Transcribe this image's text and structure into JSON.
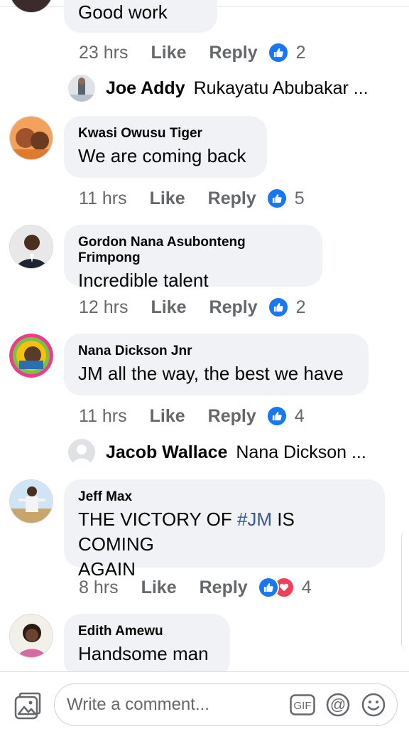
{
  "comments": [
    {
      "author": "",
      "text": "Good work",
      "time": "23 hrs",
      "like": "Like",
      "reply": "Reply",
      "reaction_count": "2",
      "reply_preview": {
        "name": "Joe Addy",
        "text": "Rukayatu Abubakar ..."
      }
    },
    {
      "author": "Kwasi Owusu Tiger",
      "text": "We are coming back",
      "time": "11 hrs",
      "like": "Like",
      "reply": "Reply",
      "reaction_count": "5"
    },
    {
      "author": "Gordon Nana Asubonteng Frimpong",
      "text": "Incredible talent",
      "time": "12 hrs",
      "like": "Like",
      "reply": "Reply",
      "reaction_count": "2"
    },
    {
      "author": "Nana Dickson Jnr",
      "text": "JM all the way, the best we have",
      "time": "11 hrs",
      "like": "Like",
      "reply": "Reply",
      "reaction_count": "4",
      "reply_preview": {
        "name": "Jacob Wallace",
        "text": "Nana Dickson ..."
      }
    },
    {
      "author": "Jeff Max",
      "text_before": "THE VICTORY OF ",
      "hashtag": "#JM",
      "text_after": " IS COMING",
      "text_line2": "AGAIN",
      "time": "8 hrs",
      "like": "Like",
      "reply": "Reply",
      "reaction_count": "4"
    },
    {
      "author": "Edith Amewu",
      "text": "Handsome man"
    }
  ],
  "composer": {
    "placeholder": "Write a comment...",
    "gif_label": "GIF",
    "at_symbol": "@"
  },
  "colors": {
    "like_blue": "#1877f2",
    "love_red": "#f33e58",
    "bubble_gray": "#f0f2f5",
    "meta_gray": "#65676b",
    "hashtag": "#385898"
  },
  "icons": [
    "like-reaction-icon",
    "love-reaction-icon",
    "photo-icon",
    "gif-icon",
    "mention-icon",
    "emoji-icon",
    "avatar-placeholder-icon"
  ]
}
